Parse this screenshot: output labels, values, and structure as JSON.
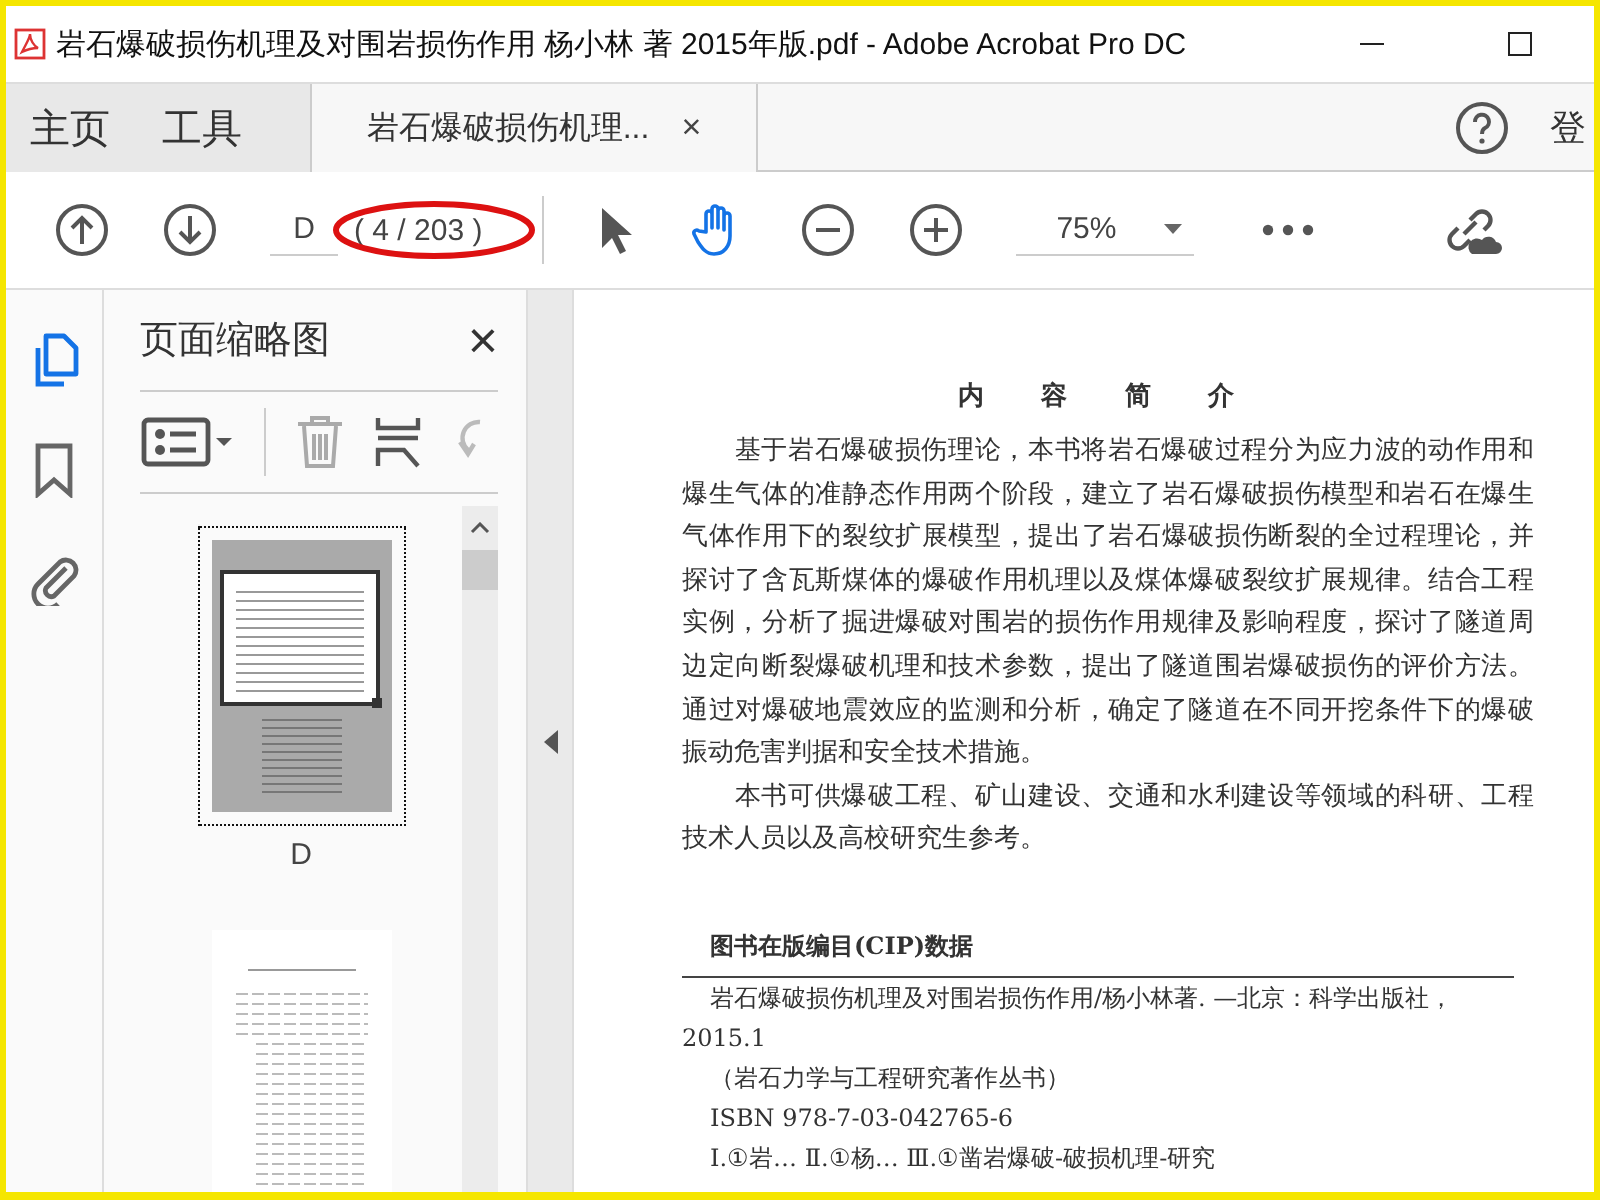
{
  "window": {
    "title": "岩石爆破损伤机理及对围岩损伤作用 杨小林 著 2015年版.pdf - Adobe Acrobat Pro DC"
  },
  "tabs": [
    {
      "label": "主页",
      "kind": "nav",
      "selected": false
    },
    {
      "label": "工具",
      "kind": "nav",
      "selected": false
    },
    {
      "label": "岩石爆破损伤机理...",
      "kind": "doc",
      "selected": true,
      "close": "×"
    }
  ],
  "account_label": "登",
  "toolbar": {
    "page_field": "D",
    "page_count": "( 4 / 203 )",
    "zoom": "75%",
    "hand_tool_selected": true
  },
  "side_rail": [
    {
      "kind": "pages",
      "selected": true
    },
    {
      "kind": "bookmark",
      "selected": false
    },
    {
      "kind": "attachment",
      "selected": false
    }
  ],
  "thumbnails_panel": {
    "title": "页面缩略图",
    "close": "×",
    "thumbnails": [
      {
        "label": "D",
        "selected": true,
        "kind": "summary"
      },
      {
        "selected": false,
        "kind": "list"
      }
    ]
  },
  "page": {
    "heading": "内 容 简 介",
    "paragraphs": [
      "基于岩石爆破损伤理论，本书将岩石爆破过程分为应力波的动作用和爆生气体的准静态作用两个阶段，建立了岩石爆破损伤模型和岩石在爆生气体作用下的裂纹扩展模型，提出了岩石爆破损伤断裂的全过程理论，并探讨了含瓦斯煤体的爆破作用机理以及煤体爆破裂纹扩展规律。结合工程实例，分析了掘进爆破对围岩的损伤作用规律及影响程度，探讨了隧道周边定向断裂爆破机理和技术参数，提出了隧道围岩爆破损伤的评价方法。通过对爆破地震效应的监测和分析，确定了隧道在不同开挖条件下的爆破振动危害判据和安全技术措施。",
      "本书可供爆破工程、矿山建设、交通和水利建设等领域的科研、工程技术人员以及高校研究生参考。"
    ],
    "cip_heading": "图书在版编目(CIP)数据",
    "cip_lines": [
      "岩石爆破损伤机理及对围岩损伤作用/杨小林著. —北京：科学出版社，",
      "2015.1",
      "（岩石力学与工程研究著作丛书）",
      "ISBN 978-7-03-042765-6",
      "Ⅰ.①岩…  Ⅱ.①杨…  Ⅲ.①凿岩爆破-破损机理-研究"
    ]
  }
}
